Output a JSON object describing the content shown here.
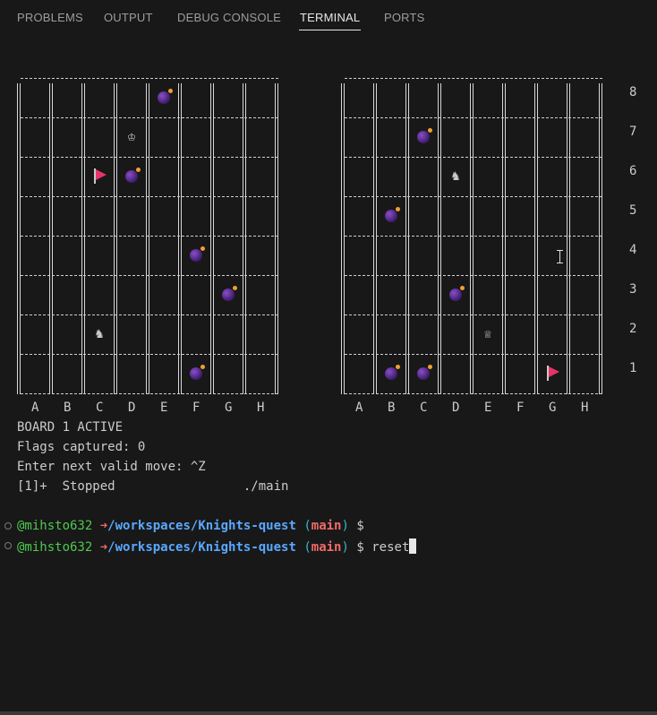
{
  "tabs": [
    "PROBLEMS",
    "OUTPUT",
    "DEBUG CONSOLE",
    "TERMINAL",
    "PORTS"
  ],
  "active_tab": "TERMINAL",
  "boards": {
    "columns": [
      "A",
      "B",
      "C",
      "D",
      "E",
      "F",
      "G",
      "H"
    ],
    "rows": [
      "8",
      "7",
      "6",
      "5",
      "4",
      "3",
      "2",
      "1"
    ],
    "board1_pieces": [
      {
        "type": "bomb",
        "square": "E8"
      },
      {
        "type": "king",
        "square": "D7",
        "glyph": "♔"
      },
      {
        "type": "flag",
        "square": "C6"
      },
      {
        "type": "bomb",
        "square": "D6"
      },
      {
        "type": "bomb",
        "square": "F4"
      },
      {
        "type": "bomb",
        "square": "G3"
      },
      {
        "type": "knight",
        "square": "C2",
        "glyph": "♞"
      },
      {
        "type": "bomb",
        "square": "F1"
      }
    ],
    "board2_pieces": [
      {
        "type": "bomb",
        "square": "C7"
      },
      {
        "type": "knight",
        "square": "D6",
        "glyph": "♞"
      },
      {
        "type": "bomb",
        "square": "B5"
      },
      {
        "type": "bomb",
        "square": "D3"
      },
      {
        "type": "queen",
        "square": "E2",
        "glyph": "♕"
      },
      {
        "type": "bomb",
        "square": "B1"
      },
      {
        "type": "bomb",
        "square": "C1"
      },
      {
        "type": "flag",
        "square": "G1"
      }
    ]
  },
  "terminal": {
    "line1": "BOARD 1 ACTIVE",
    "line2": "Flags captured: 0",
    "line3": "Enter next valid move: ^Z",
    "line4": "[1]+  Stopped                 ./main",
    "prompt": {
      "user": "@mihsto632",
      "arrow": "➜",
      "path": "/workspaces/Knights-quest",
      "branch_open": "(",
      "branch": "main",
      "branch_close": ")",
      "dollar": "$"
    },
    "typed_command": "reset"
  },
  "colors": {
    "background": "#181818",
    "bomb": "#5b2d9a",
    "flag": "#e8336a",
    "user": "#4ec94e",
    "path": "#5aa8ff",
    "branch": "#f06a6a"
  }
}
